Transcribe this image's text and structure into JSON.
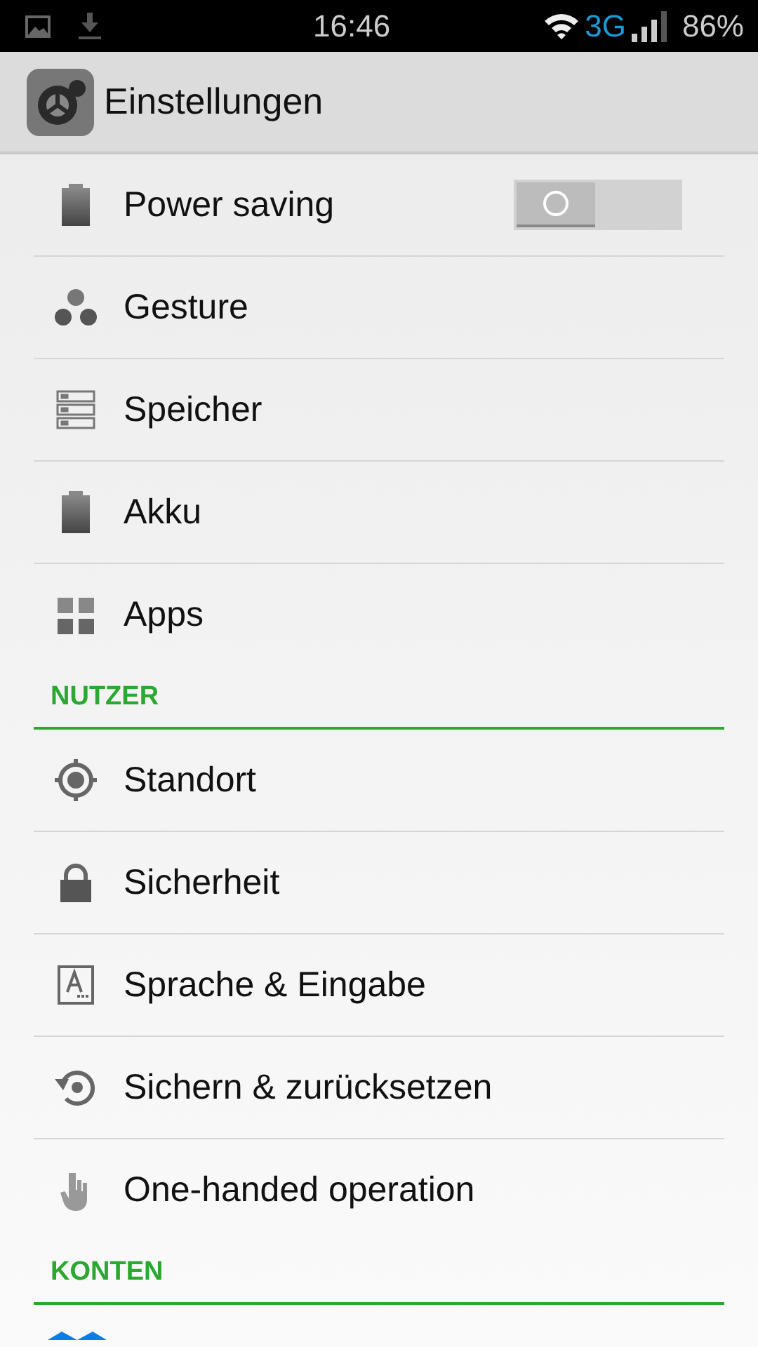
{
  "status_bar": {
    "time": "16:46",
    "network": "3G",
    "battery": "86%"
  },
  "action_bar": {
    "title": "Einstellungen"
  },
  "sections": [
    {
      "items": [
        {
          "label": "Power saving",
          "kind": "toggle",
          "on": false
        },
        {
          "label": "Gesture",
          "kind": "link"
        },
        {
          "label": "Speicher",
          "kind": "link"
        },
        {
          "label": "Akku",
          "kind": "link"
        },
        {
          "label": "Apps",
          "kind": "link"
        }
      ]
    },
    {
      "header": "NUTZER",
      "items": [
        {
          "label": "Standort",
          "kind": "link"
        },
        {
          "label": "Sicherheit",
          "kind": "link"
        },
        {
          "label": "Sprache & Eingabe",
          "kind": "link"
        },
        {
          "label": "Sichern & zurücksetzen",
          "kind": "link"
        },
        {
          "label": "One-handed operation",
          "kind": "link"
        }
      ]
    },
    {
      "header": "KONTEN"
    }
  ]
}
